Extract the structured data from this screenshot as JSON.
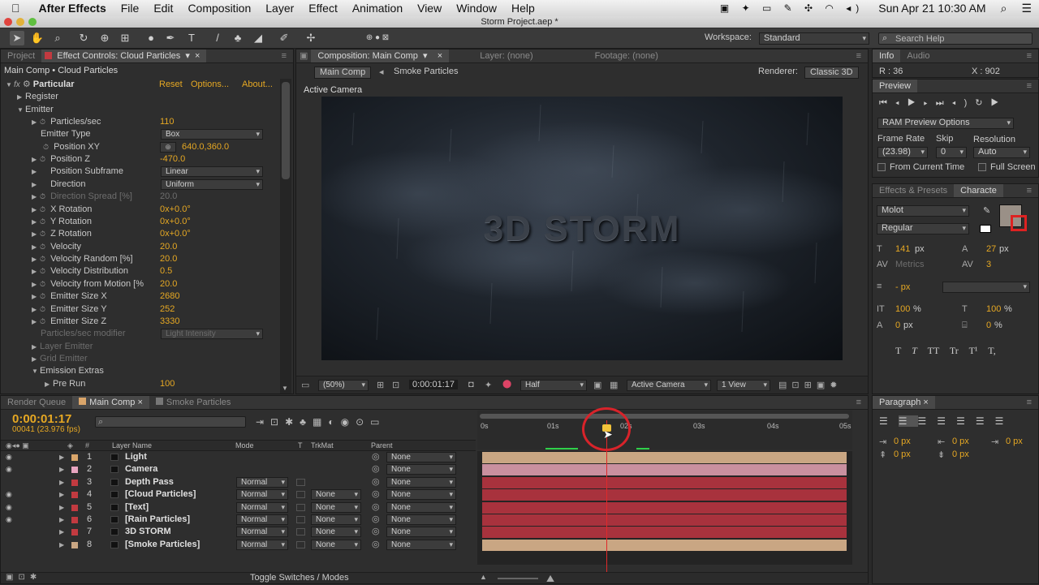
{
  "menubar": {
    "app": "After Effects",
    "items": [
      "File",
      "Edit",
      "Composition",
      "Layer",
      "Effect",
      "Animation",
      "View",
      "Window",
      "Help"
    ],
    "clock": "Sun Apr 21  10:30 AM"
  },
  "titlebar": {
    "title": "Storm Project.aep *"
  },
  "toolbar": {
    "workspace_label": "Workspace:",
    "workspace_value": "Standard",
    "search_placeholder": "Search Help"
  },
  "effect_panel": {
    "tab_project": "Project",
    "tab_effect": "Effect Controls: Cloud Particles",
    "breadcrumb": "Main Comp • Cloud Particles",
    "effect_name": "Particular",
    "reset": "Reset",
    "options": "Options...",
    "about": "About...",
    "rows": [
      {
        "name": "Register",
        "value": ""
      },
      {
        "name": "Emitter",
        "value": ""
      },
      {
        "name": "Particles/sec",
        "value": "110"
      },
      {
        "name": "Emitter Type",
        "value": "Box"
      },
      {
        "name": "Position XY",
        "value": "640.0,360.0"
      },
      {
        "name": "Position Z",
        "value": "-470.0"
      },
      {
        "name": "Position Subframe",
        "value": "Linear"
      },
      {
        "name": "Direction",
        "value": "Uniform"
      },
      {
        "name": "Direction Spread [%]",
        "value": "20.0"
      },
      {
        "name": "X Rotation",
        "value": "0x+0.0°"
      },
      {
        "name": "Y Rotation",
        "value": "0x+0.0°"
      },
      {
        "name": "Z Rotation",
        "value": "0x+0.0°"
      },
      {
        "name": "Velocity",
        "value": "20.0"
      },
      {
        "name": "Velocity Random [%]",
        "value": "20.0"
      },
      {
        "name": "Velocity Distribution",
        "value": "0.5"
      },
      {
        "name": "Velocity from Motion [%",
        "value": "20.0"
      },
      {
        "name": "Emitter Size X",
        "value": "2680"
      },
      {
        "name": "Emitter Size Y",
        "value": "252"
      },
      {
        "name": "Emitter Size Z",
        "value": "3330"
      },
      {
        "name": "Particles/sec modifier",
        "value": "Light Intensity"
      },
      {
        "name": "Layer Emitter",
        "value": ""
      },
      {
        "name": "Grid Emitter",
        "value": ""
      },
      {
        "name": "Emission Extras",
        "value": ""
      },
      {
        "name": "Pre Run",
        "value": "100"
      }
    ]
  },
  "comp_panel": {
    "tab_comp": "Composition: Main Comp",
    "tab_layer": "Layer: (none)",
    "tab_footage": "Footage: (none)",
    "crumb_main": "Main Comp",
    "crumb_smoke": "Smoke Particles",
    "renderer_label": "Renderer:",
    "renderer_value": "Classic 3D",
    "view_label": "Active Camera",
    "title_text": "3D STORM",
    "zoom": "(50%)",
    "timecode": "0:00:01:17",
    "resolution": "Half",
    "camera": "Active Camera",
    "views": "1 View"
  },
  "info_panel": {
    "tab_info": "Info",
    "tab_audio": "Audio",
    "r": "R : 36",
    "x": "X : 902"
  },
  "preview_panel": {
    "tab": "Preview",
    "ram_options": "RAM Preview Options",
    "frame_rate_label": "Frame Rate",
    "skip_label": "Skip",
    "resolution_label": "Resolution",
    "frame_rate": "(23.98)",
    "skip": "0",
    "resolution": "Auto",
    "from_current": "From Current Time",
    "full_screen": "Full Screen"
  },
  "character_panel": {
    "tab_effects": "Effects & Presets",
    "tab_character": "Characte",
    "font": "Molot",
    "style": "Regular",
    "size": "141",
    "size_unit": "px",
    "leading": "27",
    "leading_unit": "px",
    "kerning": "Metrics",
    "tracking": "3",
    "stroke": "- px",
    "vscale": "100",
    "hscale": "100",
    "baseline": "0",
    "tsume": "0",
    "px": "px",
    "pct": "%",
    "styles": [
      "T",
      "T",
      "TT",
      "Tr",
      "T¹",
      "T,"
    ]
  },
  "paragraph_panel": {
    "tab": "Paragraph",
    "vals": [
      "0 px",
      "0 px",
      "0 px",
      "0 px",
      "0 px"
    ]
  },
  "timeline": {
    "tab_render": "Render Queue",
    "tab_main": "Main Comp",
    "tab_smoke": "Smoke Particles",
    "timecode": "0:00:01:17",
    "frames": "00041 (23.976 fps)",
    "col_name": "Layer Name",
    "col_mode": "Mode",
    "col_t": "T",
    "col_trkmat": "TrkMat",
    "col_parent": "Parent",
    "ruler": [
      "0s",
      "01s",
      "02s",
      "03s",
      "04s",
      "05s"
    ],
    "toggle": "Toggle Switches / Modes",
    "layers": [
      {
        "num": "1",
        "name": "Light",
        "mode": "",
        "trkmat": "",
        "parent": "None",
        "color": "#d9a56a",
        "bar": "#c9a683"
      },
      {
        "num": "2",
        "name": "Camera",
        "mode": "",
        "trkmat": "",
        "parent": "None",
        "color": "#e8a5c0",
        "bar": "#c9909f"
      },
      {
        "num": "3",
        "name": "Depth Pass",
        "mode": "Normal",
        "trkmat": "",
        "parent": "None",
        "color": "#c23a40",
        "bar": "#a8323d"
      },
      {
        "num": "4",
        "name": "[Cloud Particles]",
        "mode": "Normal",
        "trkmat": "None",
        "parent": "None",
        "color": "#c23a40",
        "bar": "#a8323d"
      },
      {
        "num": "5",
        "name": "[Text]",
        "mode": "Normal",
        "trkmat": "None",
        "parent": "None",
        "color": "#c23a40",
        "bar": "#a8323d"
      },
      {
        "num": "6",
        "name": "[Rain Particles]",
        "mode": "Normal",
        "trkmat": "None",
        "parent": "None",
        "color": "#c23a40",
        "bar": "#a8323d"
      },
      {
        "num": "7",
        "name": "3D STORM",
        "mode": "Normal",
        "trkmat": "None",
        "parent": "None",
        "color": "#c23a40",
        "bar": "#a8323d"
      },
      {
        "num": "8",
        "name": "[Smoke Particles]",
        "mode": "Normal",
        "trkmat": "None",
        "parent": "None",
        "color": "#c9a683",
        "bar": "#c9a683"
      }
    ]
  }
}
